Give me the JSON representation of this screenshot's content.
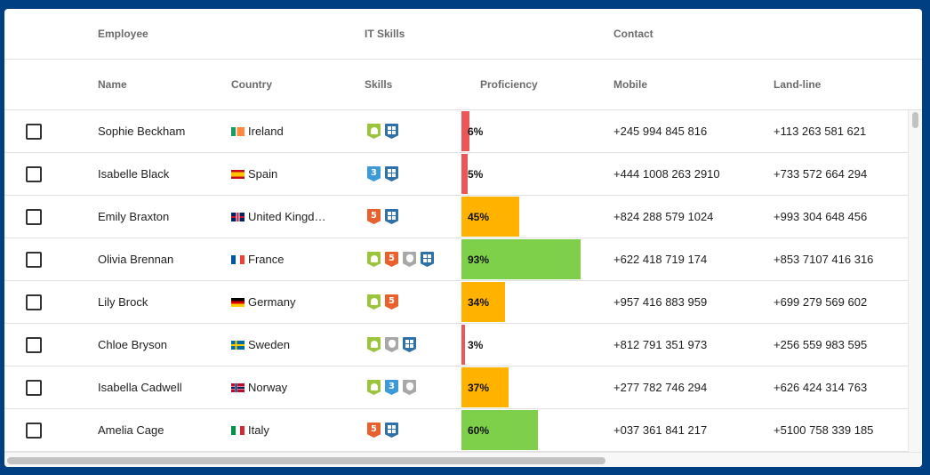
{
  "header_groups": [
    {
      "label": "Employee"
    },
    {
      "label": "IT Skills"
    },
    {
      "label": "Contact"
    }
  ],
  "columns": [
    {
      "key": "name",
      "label": "Name"
    },
    {
      "key": "country",
      "label": "Country"
    },
    {
      "key": "skills",
      "label": "Skills"
    },
    {
      "key": "proficiency",
      "label": "Proficiency"
    },
    {
      "key": "mobile",
      "label": "Mobile"
    },
    {
      "key": "landline",
      "label": "Land-line"
    }
  ],
  "colors": {
    "background": "#003f82",
    "proficiency_low": "#eb5757",
    "proficiency_mid": "#ffb300",
    "proficiency_high": "#7ed04b",
    "android": "#9bc53d",
    "html5": "#e8602c",
    "css3": "#3d9ad8",
    "mac": "#a8a8a8",
    "windows": "#2e70a8"
  },
  "rows": [
    {
      "selected": false,
      "name": "Sophie Beckham",
      "country": "Ireland",
      "flag": "flag-ireland",
      "skills": [
        "android",
        "windows"
      ],
      "proficiency": 6,
      "proficiency_label": "6%",
      "mobile": "+245 994 845 816",
      "landline": "+113 263 581 621"
    },
    {
      "selected": false,
      "name": "Isabelle Black",
      "country": "Spain",
      "flag": "flag-spain",
      "skills": [
        "css3",
        "windows"
      ],
      "proficiency": 5,
      "proficiency_label": "5%",
      "mobile": "+444 1008 263 2910",
      "landline": "+733 572 664 294"
    },
    {
      "selected": false,
      "name": "Emily Braxton",
      "country": "United Kingd…",
      "flag": "flag-united-kingdom",
      "skills": [
        "html5",
        "windows"
      ],
      "proficiency": 45,
      "proficiency_label": "45%",
      "mobile": "+824 288 579 1024",
      "landline": "+993 304 648 456"
    },
    {
      "selected": false,
      "name": "Olivia Brennan",
      "country": "France",
      "flag": "flag-france",
      "skills": [
        "android",
        "html5",
        "mac",
        "windows"
      ],
      "proficiency": 93,
      "proficiency_label": "93%",
      "mobile": "+622 418 719 174",
      "landline": "+853 7107 416 316"
    },
    {
      "selected": false,
      "name": "Lily Brock",
      "country": "Germany",
      "flag": "flag-germany",
      "skills": [
        "android",
        "html5"
      ],
      "proficiency": 34,
      "proficiency_label": "34%",
      "mobile": "+957 416 883 959",
      "landline": "+699 279 569 602"
    },
    {
      "selected": false,
      "name": "Chloe Bryson",
      "country": "Sweden",
      "flag": "flag-sweden",
      "skills": [
        "android",
        "mac",
        "windows"
      ],
      "proficiency": 3,
      "proficiency_label": "3%",
      "mobile": "+812 791 351 973",
      "landline": "+256 559 983 595"
    },
    {
      "selected": false,
      "name": "Isabella Cadwell",
      "country": "Norway",
      "flag": "flag-norway",
      "skills": [
        "android",
        "css3",
        "mac"
      ],
      "proficiency": 37,
      "proficiency_label": "37%",
      "mobile": "+277 782 746 294",
      "landline": "+626 424 314 763"
    },
    {
      "selected": false,
      "name": "Amelia Cage",
      "country": "Italy",
      "flag": "flag-italy",
      "skills": [
        "html5",
        "windows"
      ],
      "proficiency": 60,
      "proficiency_label": "60%",
      "mobile": "+037 361 841 217",
      "landline": "+5100 758 339 185"
    }
  ]
}
